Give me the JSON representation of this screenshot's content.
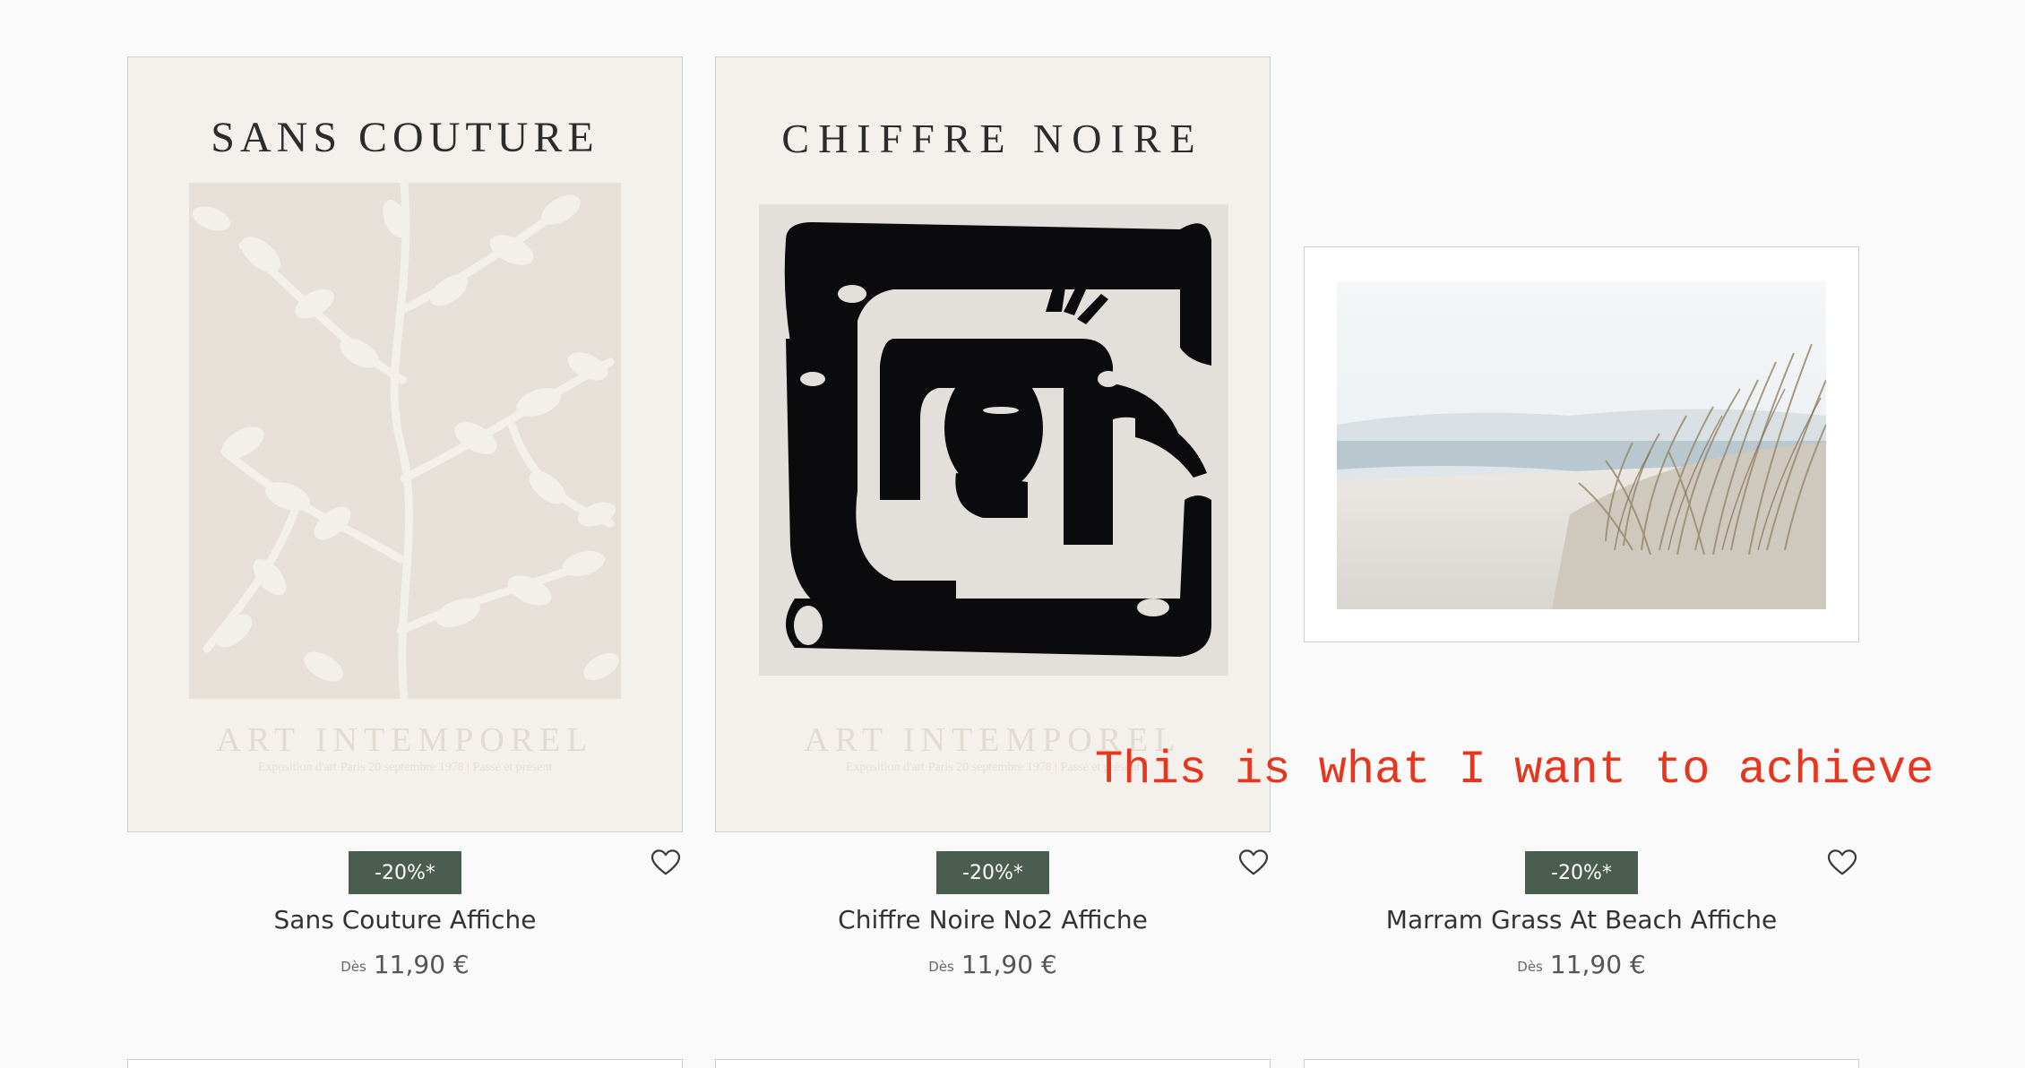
{
  "products": [
    {
      "name": "Sans Couture Affiche",
      "badge": "-20%*",
      "price_prefix": "Dès",
      "price": "11,90 €",
      "poster_title": "SANS COUTURE",
      "poster_footer": "ART INTEMPOREL",
      "poster_footer_sub": "Exposition d'art Paris 20 septembre 1978 | Passé et présent"
    },
    {
      "name": "Chiffre Noire No2 Affiche",
      "badge": "-20%*",
      "price_prefix": "Dès",
      "price": "11,90 €",
      "poster_title": "CHIFFRE NOIRE",
      "poster_footer": "ART INTEMPOREL",
      "poster_footer_sub": "Exposition d'art Paris 20 septembre 1978 | Passé et présent"
    },
    {
      "name": "Marram Grass At Beach Affiche",
      "badge": "-20%*",
      "price_prefix": "Dès",
      "price": "11,90 €"
    }
  ],
  "annotation": "This is what I want to achieve",
  "colors": {
    "badge_bg": "#4a5d50",
    "annotation": "#e8351d",
    "poster_bg": "#f4f1ec"
  },
  "icons": {
    "wishlist": "heart-outline-icon"
  }
}
